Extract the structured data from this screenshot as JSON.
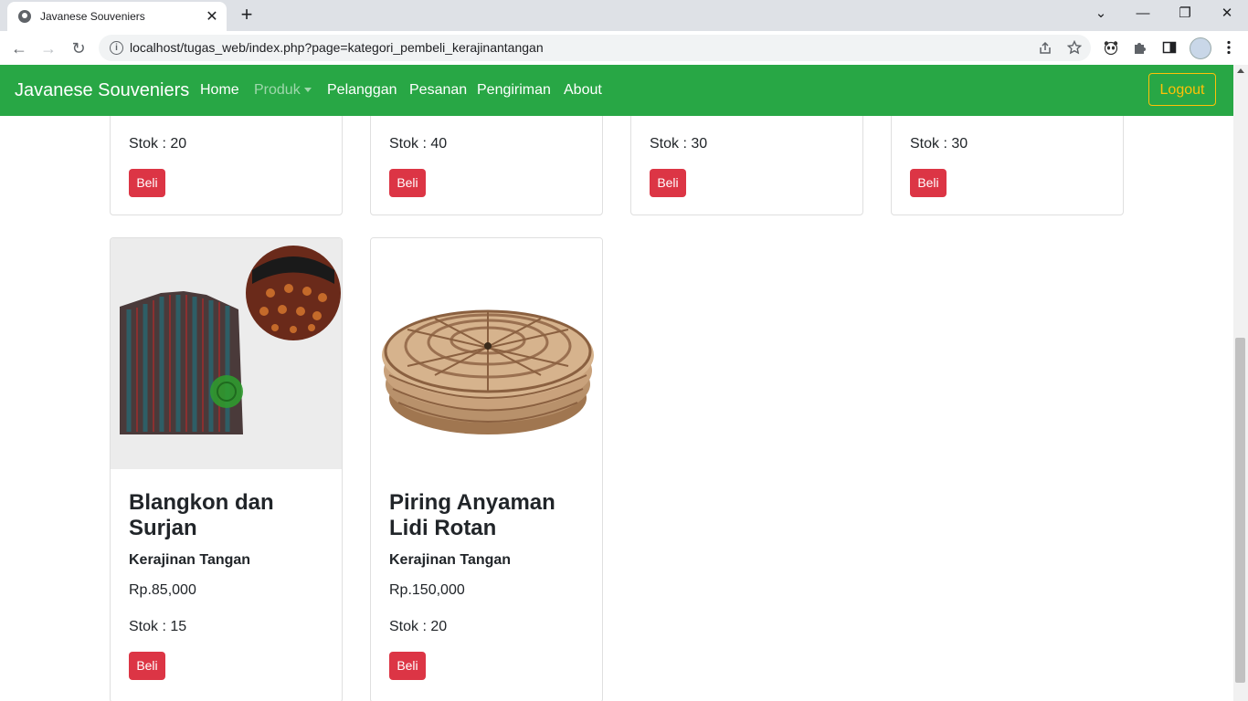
{
  "browser": {
    "tab_title": "Javanese Souveniers",
    "tab_close": "✕",
    "new_tab": "+",
    "url": "localhost/tugas_web/index.php?page=kategori_pembeli_kerajinantangan",
    "window_controls": [
      "⌄",
      "—",
      "❐",
      "✕"
    ],
    "nav": [
      "←",
      "→",
      "↻"
    ]
  },
  "navbar": {
    "brand": "Javanese Souveniers",
    "links": [
      "Home",
      "Produk",
      "Pelanggan",
      "Pesanan",
      "Pengiriman",
      "About"
    ],
    "logout": "Logout"
  },
  "top_cards": [
    {
      "stok": "Stok : 20",
      "button": "Beli"
    },
    {
      "stok": "Stok : 40",
      "button": "Beli"
    },
    {
      "stok": "Stok : 30",
      "button": "Beli"
    },
    {
      "stok": "Stok : 30",
      "button": "Beli"
    }
  ],
  "products": [
    {
      "title": "Blangkon dan Surjan",
      "category": "Kerajinan Tangan",
      "price": "Rp.85,000",
      "stok": "Stok : 15",
      "button": "Beli"
    },
    {
      "title": "Piring Anyaman Lidi Rotan",
      "category": "Kerajinan Tangan",
      "price": "Rp.150,000",
      "stok": "Stok : 20",
      "button": "Beli"
    }
  ],
  "colors": {
    "navbar": "#28a745",
    "button": "#dc3545",
    "logout": "#ffc107"
  }
}
